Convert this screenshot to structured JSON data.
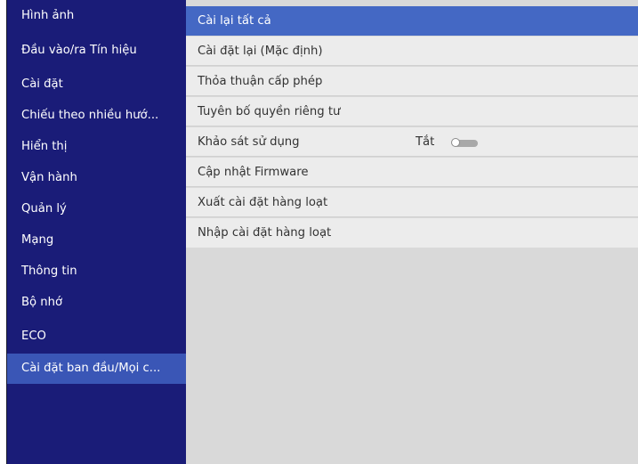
{
  "sidebar": {
    "items": [
      {
        "label": "Hình ảnh"
      },
      {
        "label": "Đầu vào/ra Tín hiệu"
      },
      {
        "label": "Cài đặt"
      },
      {
        "label": "Chiếu theo nhiều hướ..."
      },
      {
        "label": "Hiển thị"
      },
      {
        "label": "Vận hành"
      },
      {
        "label": "Quản lý"
      },
      {
        "label": "Mạng"
      },
      {
        "label": "Thông tin"
      },
      {
        "label": "Bộ nhớ"
      },
      {
        "label": "ECO"
      },
      {
        "label": "Cài đặt ban đầu/Mọi c..."
      }
    ],
    "active_index": 11
  },
  "menu": {
    "items": [
      {
        "label": "Cài lại tất cả"
      },
      {
        "label": "Cài đặt lại (Mặc định)"
      },
      {
        "label": "Thỏa thuận cấp phép"
      },
      {
        "label": "Tuyên bố quyền riêng tư"
      },
      {
        "label": "Khảo sát sử dụng",
        "value": "Tắt",
        "toggle_on": false
      },
      {
        "label": "Cập nhật Firmware"
      },
      {
        "label": "Xuất cài đặt hàng loạt"
      },
      {
        "label": "Nhập cài đặt hàng loạt"
      }
    ],
    "active_index": 0
  },
  "colors": {
    "sidebar_bg": "#1a1c78",
    "sidebar_active": "#3a56b6",
    "menu_active": "#4468c4",
    "menu_bg": "#ececec",
    "panel_bg": "#d9d9d9"
  }
}
